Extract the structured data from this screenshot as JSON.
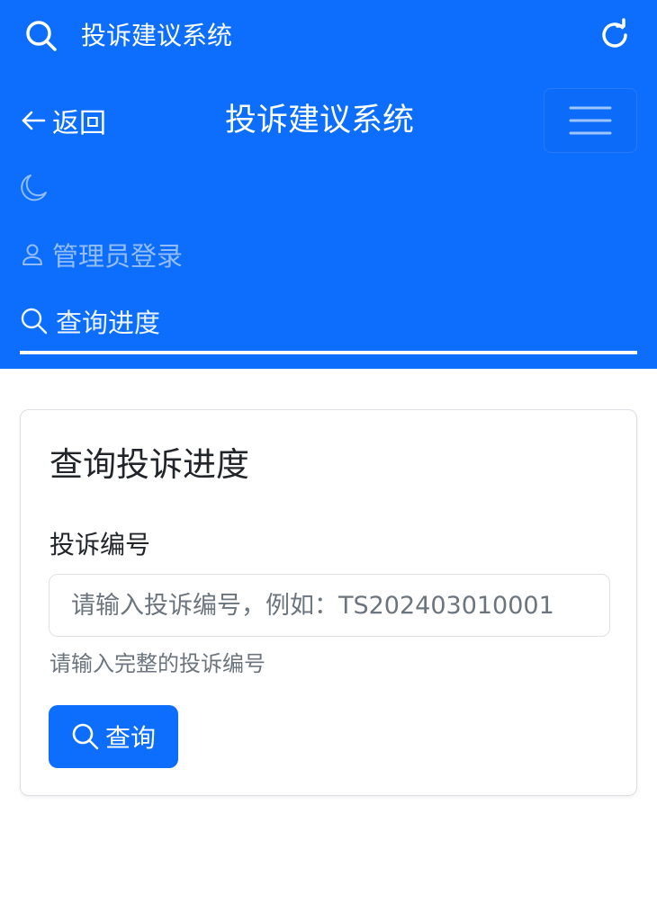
{
  "browser": {
    "url_title": "投诉建议系统",
    "icons": {
      "search": "search-icon",
      "reload": "reload-icon"
    }
  },
  "navbar": {
    "back_label": "返回",
    "brand": "投诉建议系统",
    "toggler_icon": "hamburger-menu-icon",
    "theme_icon": "moon-icon",
    "items": [
      {
        "label": "管理员登录",
        "icon": "user-icon",
        "active": false
      },
      {
        "label": "查询进度",
        "icon": "search-icon",
        "active": true
      }
    ],
    "color": "#0d6efd"
  },
  "card": {
    "title": "查询投诉进度",
    "field_label": "投诉编号",
    "input_value": "",
    "input_placeholder": "请输入投诉编号，例如：TS202403010001",
    "help_text": "请输入完整的投诉编号",
    "submit_label": "查询"
  }
}
